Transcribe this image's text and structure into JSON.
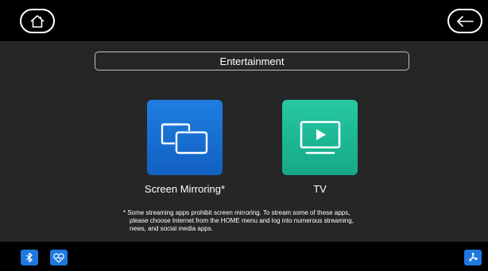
{
  "header": {
    "home_icon": "home-icon",
    "back_icon": "back-arrow-icon"
  },
  "page": {
    "title": "Entertainment"
  },
  "tiles": [
    {
      "label": "Screen Mirroring*",
      "icon": "screen-mirroring-icon",
      "color": "#1a6fd4"
    },
    {
      "label": "TV",
      "icon": "tv-play-icon",
      "color": "#1fba96"
    }
  ],
  "note": {
    "line1": "* Some streaming apps prohibit screen mirroring. To stream some of these apps,",
    "line2": "please choose Internet from the HOME menu and log into numerous streaming,",
    "line3": "news, and social media apps."
  },
  "footer": {
    "bluetooth_icon": "bluetooth-icon",
    "health_icon": "heart-pulse-icon",
    "fan_icon": "fan-icon"
  },
  "colors": {
    "background": "#262626",
    "bar": "#000000",
    "accent_blue": "#1e78e0",
    "accent_green": "#1fba96"
  }
}
